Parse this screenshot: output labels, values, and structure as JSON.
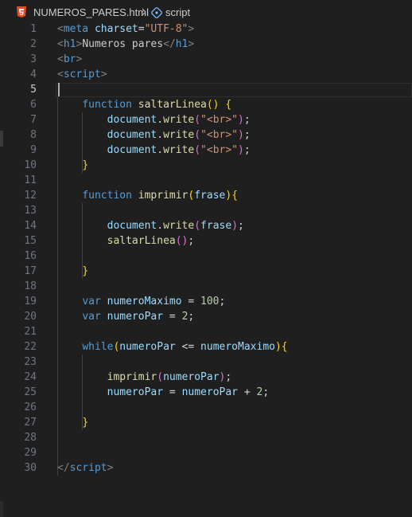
{
  "breadcrumb": {
    "file": "NUMEROS_PARES.html",
    "symbol": "script",
    "file_icon": "html5-icon",
    "symbol_icon": "symbol-namespace-icon",
    "separator_icon": "chevron-right-icon"
  },
  "editor": {
    "active_line": 5,
    "lines": [
      {
        "n": "1",
        "tokens": [
          [
            "punc",
            "<"
          ],
          [
            "tag",
            "meta"
          ],
          [
            "text",
            " "
          ],
          [
            "attr",
            "charset"
          ],
          [
            "op",
            "="
          ],
          [
            "str",
            "\"UTF-8\""
          ],
          [
            "punc",
            ">"
          ]
        ]
      },
      {
        "n": "2",
        "tokens": [
          [
            "punc",
            "<"
          ],
          [
            "tag",
            "h1"
          ],
          [
            "punc",
            ">"
          ],
          [
            "text",
            "Numeros pares"
          ],
          [
            "punc",
            "</"
          ],
          [
            "tag",
            "h1"
          ],
          [
            "punc",
            ">"
          ]
        ]
      },
      {
        "n": "3",
        "tokens": [
          [
            "punc",
            "<"
          ],
          [
            "tag",
            "br"
          ],
          [
            "punc",
            ">"
          ]
        ]
      },
      {
        "n": "4",
        "tokens": [
          [
            "punc",
            "<"
          ],
          [
            "tag",
            "script"
          ],
          [
            "punc",
            ">"
          ]
        ]
      },
      {
        "n": "5",
        "tokens": []
      },
      {
        "n": "6",
        "tokens": [
          [
            "text",
            "    "
          ],
          [
            "kw",
            "function"
          ],
          [
            "text",
            " "
          ],
          [
            "fn",
            "saltarLinea"
          ],
          [
            "brace",
            "()"
          ],
          [
            "text",
            " "
          ],
          [
            "brace",
            "{"
          ]
        ]
      },
      {
        "n": "7",
        "tokens": [
          [
            "text",
            "        "
          ],
          [
            "var",
            "document"
          ],
          [
            "op",
            "."
          ],
          [
            "fn",
            "write"
          ],
          [
            "paren",
            "("
          ],
          [
            "str",
            "\"<br>\""
          ],
          [
            "paren",
            ")"
          ],
          [
            "op",
            ";"
          ]
        ]
      },
      {
        "n": "8",
        "tokens": [
          [
            "text",
            "        "
          ],
          [
            "var",
            "document"
          ],
          [
            "op",
            "."
          ],
          [
            "fn",
            "write"
          ],
          [
            "paren",
            "("
          ],
          [
            "str",
            "\"<br>\""
          ],
          [
            "paren",
            ")"
          ],
          [
            "op",
            ";"
          ]
        ]
      },
      {
        "n": "9",
        "tokens": [
          [
            "text",
            "        "
          ],
          [
            "var",
            "document"
          ],
          [
            "op",
            "."
          ],
          [
            "fn",
            "write"
          ],
          [
            "paren",
            "("
          ],
          [
            "str",
            "\"<br>\""
          ],
          [
            "paren",
            ")"
          ],
          [
            "op",
            ";"
          ]
        ]
      },
      {
        "n": "10",
        "tokens": [
          [
            "text",
            "    "
          ],
          [
            "brace",
            "}"
          ]
        ]
      },
      {
        "n": "11",
        "tokens": []
      },
      {
        "n": "12",
        "tokens": [
          [
            "text",
            "    "
          ],
          [
            "kw",
            "function"
          ],
          [
            "text",
            " "
          ],
          [
            "fn",
            "imprimir"
          ],
          [
            "brace",
            "("
          ],
          [
            "var",
            "frase"
          ],
          [
            "brace",
            ")"
          ],
          [
            "brace",
            "{"
          ]
        ]
      },
      {
        "n": "13",
        "tokens": []
      },
      {
        "n": "14",
        "tokens": [
          [
            "text",
            "        "
          ],
          [
            "var",
            "document"
          ],
          [
            "op",
            "."
          ],
          [
            "fn",
            "write"
          ],
          [
            "paren",
            "("
          ],
          [
            "var",
            "frase"
          ],
          [
            "paren",
            ")"
          ],
          [
            "op",
            ";"
          ]
        ]
      },
      {
        "n": "15",
        "tokens": [
          [
            "text",
            "        "
          ],
          [
            "fn",
            "saltarLinea"
          ],
          [
            "paren",
            "()"
          ],
          [
            "op",
            ";"
          ]
        ]
      },
      {
        "n": "16",
        "tokens": []
      },
      {
        "n": "17",
        "tokens": [
          [
            "text",
            "    "
          ],
          [
            "brace",
            "}"
          ]
        ]
      },
      {
        "n": "18",
        "tokens": []
      },
      {
        "n": "19",
        "tokens": [
          [
            "text",
            "    "
          ],
          [
            "kw",
            "var"
          ],
          [
            "text",
            " "
          ],
          [
            "var",
            "numeroMaximo"
          ],
          [
            "op",
            " = "
          ],
          [
            "num",
            "100"
          ],
          [
            "op",
            ";"
          ]
        ]
      },
      {
        "n": "20",
        "tokens": [
          [
            "text",
            "    "
          ],
          [
            "kw",
            "var"
          ],
          [
            "text",
            " "
          ],
          [
            "var",
            "numeroPar"
          ],
          [
            "op",
            " = "
          ],
          [
            "num",
            "2"
          ],
          [
            "op",
            ";"
          ]
        ]
      },
      {
        "n": "21",
        "tokens": []
      },
      {
        "n": "22",
        "tokens": [
          [
            "text",
            "    "
          ],
          [
            "kw",
            "while"
          ],
          [
            "brace",
            "("
          ],
          [
            "var",
            "numeroPar"
          ],
          [
            "op",
            " <= "
          ],
          [
            "var",
            "numeroMaximo"
          ],
          [
            "brace",
            ")"
          ],
          [
            "brace",
            "{"
          ]
        ]
      },
      {
        "n": "23",
        "tokens": []
      },
      {
        "n": "24",
        "tokens": [
          [
            "text",
            "        "
          ],
          [
            "fn",
            "imprimir"
          ],
          [
            "paren",
            "("
          ],
          [
            "var",
            "numeroPar"
          ],
          [
            "paren",
            ")"
          ],
          [
            "op",
            ";"
          ]
        ]
      },
      {
        "n": "25",
        "tokens": [
          [
            "text",
            "        "
          ],
          [
            "var",
            "numeroPar"
          ],
          [
            "op",
            " = "
          ],
          [
            "var",
            "numeroPar"
          ],
          [
            "op",
            " + "
          ],
          [
            "num",
            "2"
          ],
          [
            "op",
            ";"
          ]
        ]
      },
      {
        "n": "26",
        "tokens": []
      },
      {
        "n": "27",
        "tokens": [
          [
            "text",
            "    "
          ],
          [
            "brace",
            "}"
          ]
        ]
      },
      {
        "n": "28",
        "tokens": []
      },
      {
        "n": "29",
        "tokens": []
      },
      {
        "n": "30",
        "tokens": [
          [
            "punc",
            "</"
          ],
          [
            "tag",
            "script"
          ],
          [
            "punc",
            ">"
          ]
        ]
      }
    ]
  }
}
